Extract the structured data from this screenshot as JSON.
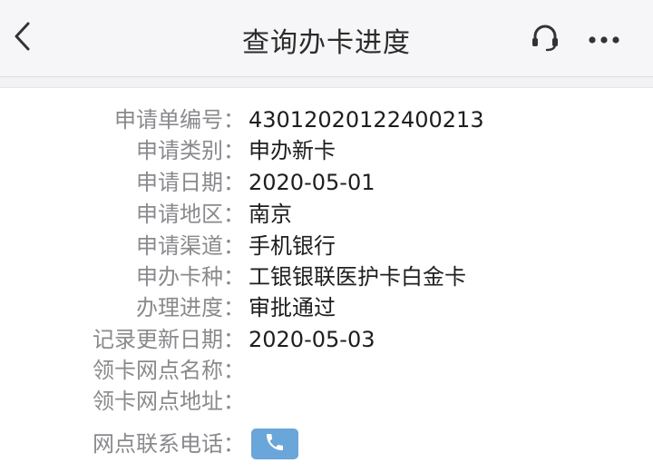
{
  "header": {
    "title": "查询办卡进度",
    "back_icon": "chevron-left-icon",
    "service_icon": "headset-icon",
    "more_icon": "more-dots-icon"
  },
  "details": {
    "rows": [
      {
        "label": "申请单编号：",
        "value": "43012020122400213"
      },
      {
        "label": "申请类别：",
        "value": "申办新卡"
      },
      {
        "label": "申请日期：",
        "value": "2020-05-01"
      },
      {
        "label": "申请地区：",
        "value": "南京"
      },
      {
        "label": "申请渠道：",
        "value": "手机银行"
      },
      {
        "label": "申办卡种：",
        "value": "工银银联医护卡白金卡"
      },
      {
        "label": "办理进度：",
        "value": "审批通过"
      },
      {
        "label": "记录更新日期：",
        "value": "2020-05-03"
      },
      {
        "label": "领卡网点名称：",
        "value": ""
      },
      {
        "label": "领卡网点地址：",
        "value": ""
      }
    ],
    "phone": {
      "label": "网点联系电话：",
      "icon": "phone-icon",
      "button_color": "#6aa6d9"
    }
  }
}
